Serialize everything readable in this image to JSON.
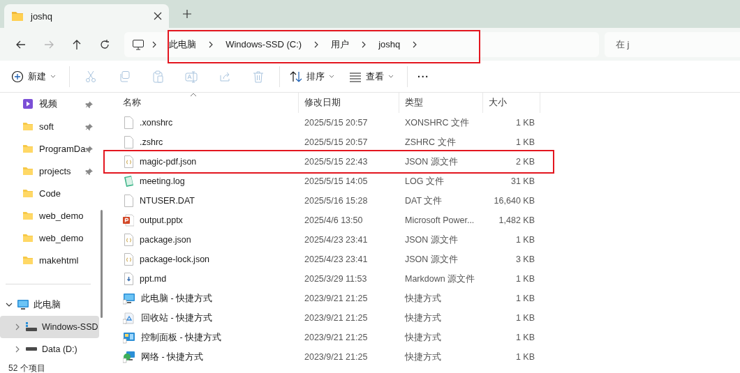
{
  "tabs": [
    {
      "title": "joshq",
      "selected": true
    }
  ],
  "nav": [
    {
      "kind": "back",
      "disabled": false
    },
    {
      "kind": "forward",
      "disabled": true
    },
    {
      "kind": "up",
      "disabled": false
    },
    {
      "kind": "refresh",
      "disabled": false
    }
  ],
  "address": {
    "crumbs": [
      "此电脑",
      "Windows-SSD (C:)",
      "用户",
      "joshq"
    ],
    "highlighted": true
  },
  "search": {
    "placeholder": "在 j"
  },
  "toolbar": [
    {
      "kind": "new",
      "label": "新建",
      "dropdown": true,
      "disabled": false
    },
    {
      "kind": "cut",
      "disabled": true
    },
    {
      "kind": "copy",
      "disabled": true
    },
    {
      "kind": "paste",
      "disabled": true
    },
    {
      "kind": "rename",
      "disabled": true
    },
    {
      "kind": "share",
      "disabled": true
    },
    {
      "kind": "delete",
      "disabled": true
    },
    {
      "kind": "sort",
      "label": "排序",
      "dropdown": true,
      "disabled": false
    },
    {
      "kind": "view",
      "label": "查看",
      "dropdown": true,
      "disabled": false
    },
    {
      "kind": "more",
      "label": "···",
      "dropdown": false,
      "disabled": false
    }
  ],
  "sidebar": {
    "quick_access": [
      {
        "label": "视频",
        "kind": "video",
        "pinned": true
      },
      {
        "label": "soft",
        "kind": "folder",
        "pinned": true
      },
      {
        "label": "ProgramDa",
        "kind": "folder",
        "pinned": true
      },
      {
        "label": "projects",
        "kind": "folder",
        "pinned": true
      },
      {
        "label": "Code",
        "kind": "folder",
        "pinned": false
      },
      {
        "label": "web_demo",
        "kind": "folder",
        "pinned": false
      },
      {
        "label": "web_demo",
        "kind": "folder",
        "pinned": false
      },
      {
        "label": "makehtml",
        "kind": "folder",
        "pinned": false
      }
    ],
    "tree": [
      {
        "label": "此电脑",
        "kind": "pc",
        "expanded": true,
        "selected": false,
        "children": [
          {
            "label": "Windows-SSD",
            "kind": "osdrive",
            "expanded": false,
            "selected": true
          },
          {
            "label": "Data (D:)",
            "kind": "drive",
            "expanded": false,
            "selected": false
          }
        ]
      }
    ]
  },
  "table": {
    "columns": [
      {
        "label": "名称",
        "sorted": true
      },
      {
        "label": "修改日期",
        "sorted": false
      },
      {
        "label": "类型",
        "sorted": false
      },
      {
        "label": "大小",
        "sorted": false
      }
    ],
    "rows": [
      {
        "kind": "file",
        "name": ".xonshrc",
        "date": "2025/5/15 20:57",
        "type": "XONSHRC 文件",
        "size": "1 KB",
        "highlighted": false
      },
      {
        "kind": "file",
        "name": ".zshrc",
        "date": "2025/5/15 20:57",
        "type": "ZSHRC 文件",
        "size": "1 KB",
        "highlighted": false
      },
      {
        "kind": "json",
        "name": "magic-pdf.json",
        "date": "2025/5/15 22:43",
        "type": "JSON 源文件",
        "size": "2 KB",
        "highlighted": true
      },
      {
        "kind": "log",
        "name": "meeting.log",
        "date": "2025/5/15 14:05",
        "type": "LOG 文件",
        "size": "31 KB",
        "highlighted": false
      },
      {
        "kind": "file",
        "name": "NTUSER.DAT",
        "date": "2025/5/16 15:28",
        "type": "DAT 文件",
        "size": "16,640 KB",
        "highlighted": false
      },
      {
        "kind": "pptx",
        "name": "output.pptx",
        "date": "2025/4/6 13:50",
        "type": "Microsoft Power...",
        "size": "1,482 KB",
        "highlighted": false
      },
      {
        "kind": "json",
        "name": "package.json",
        "date": "2025/4/23 23:41",
        "type": "JSON 源文件",
        "size": "1 KB",
        "highlighted": false
      },
      {
        "kind": "json",
        "name": "package-lock.json",
        "date": "2025/4/23 23:41",
        "type": "JSON 源文件",
        "size": "3 KB",
        "highlighted": false
      },
      {
        "kind": "md",
        "name": "ppt.md",
        "date": "2025/3/29 11:53",
        "type": "Markdown 源文件",
        "size": "1 KB",
        "highlighted": false
      },
      {
        "kind": "pc",
        "name": "此电脑 - 快捷方式",
        "date": "2023/9/21 21:25",
        "type": "快捷方式",
        "size": "1 KB",
        "highlighted": false
      },
      {
        "kind": "recycle",
        "name": "回收站 - 快捷方式",
        "date": "2023/9/21 21:25",
        "type": "快捷方式",
        "size": "1 KB",
        "highlighted": false
      },
      {
        "kind": "panel",
        "name": "控制面板 - 快捷方式",
        "date": "2023/9/21 21:25",
        "type": "快捷方式",
        "size": "1 KB",
        "highlighted": false
      },
      {
        "kind": "network",
        "name": "网络 - 快捷方式",
        "date": "2023/9/21 21:25",
        "type": "快捷方式",
        "size": "1 KB",
        "highlighted": false
      }
    ]
  },
  "status_bar": {
    "count": "52 个项目"
  }
}
